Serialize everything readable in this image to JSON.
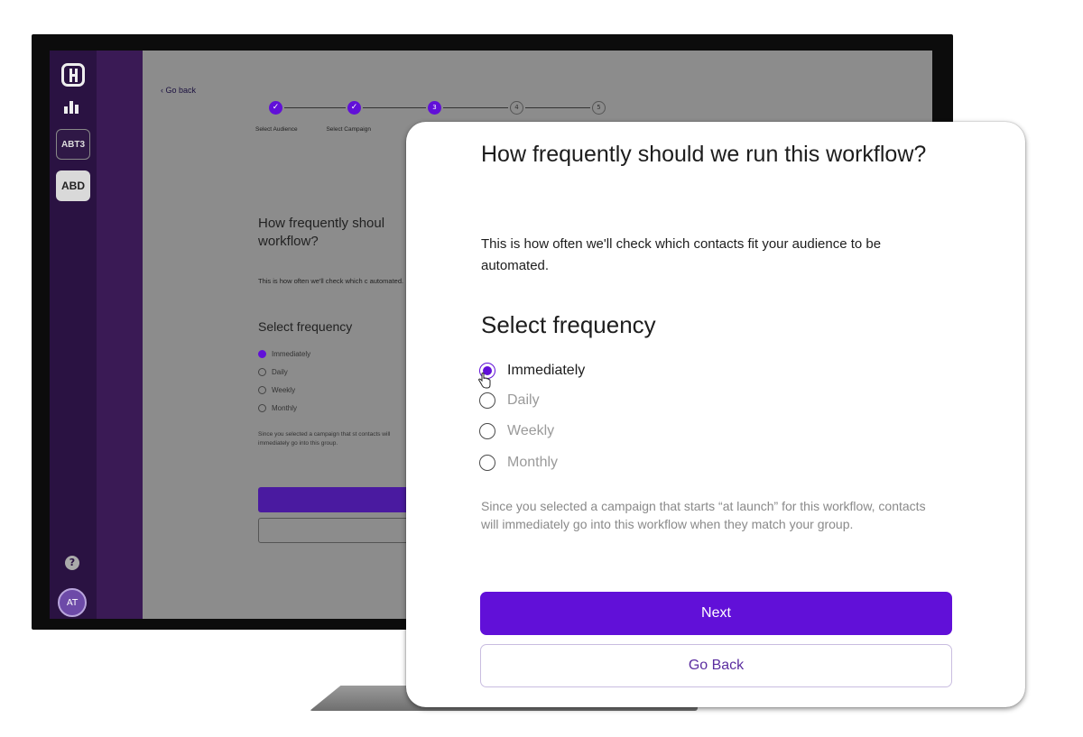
{
  "monitor": {
    "sidebar": {
      "workspaces": [
        "ABT3",
        "ABD"
      ],
      "avatar_initials": "AT",
      "help_icon": "question-circle-icon"
    },
    "main": {
      "go_back": "‹ Go back",
      "steps": {
        "items": [
          {
            "number": "1",
            "label": "Select Audience",
            "status": "done"
          },
          {
            "number": "2",
            "label": "Select Campaign",
            "status": "done"
          },
          {
            "number": "3",
            "label": "",
            "status": "current"
          },
          {
            "number": "4",
            "label": "",
            "status": "todo"
          },
          {
            "number": "5",
            "label": "",
            "status": "todo"
          }
        ]
      },
      "heading": "How frequently shoul workflow?",
      "description": "This is how often we'll check which c automated.",
      "subheading": "Select frequency",
      "options": [
        "Immediately",
        "Daily",
        "Weekly",
        "Monthly"
      ],
      "note": "Since you selected a campaign that st contacts will immediately go into this group.",
      "next_label": "Nex",
      "back_label": "Go Ba"
    }
  },
  "card": {
    "heading": "How frequently should we run this workflow?",
    "description": "This is how often we'll check which contacts fit your audience to be automated.",
    "subheading": "Select frequency",
    "frequency": {
      "selected": "Immediately",
      "options": [
        "Immediately",
        "Daily",
        "Weekly",
        "Monthly"
      ]
    },
    "note": "Since you selected a campaign that starts “at launch” for this workflow, contacts will immediately go into this workflow when they match your group.",
    "next_label": "Next",
    "back_label": "Go Back"
  },
  "colors": {
    "accent": "#6110d8",
    "sidebar_dark": "#2a1242",
    "sidebar_mid": "#3a1a55",
    "secondary_border": "#c9bde0"
  }
}
